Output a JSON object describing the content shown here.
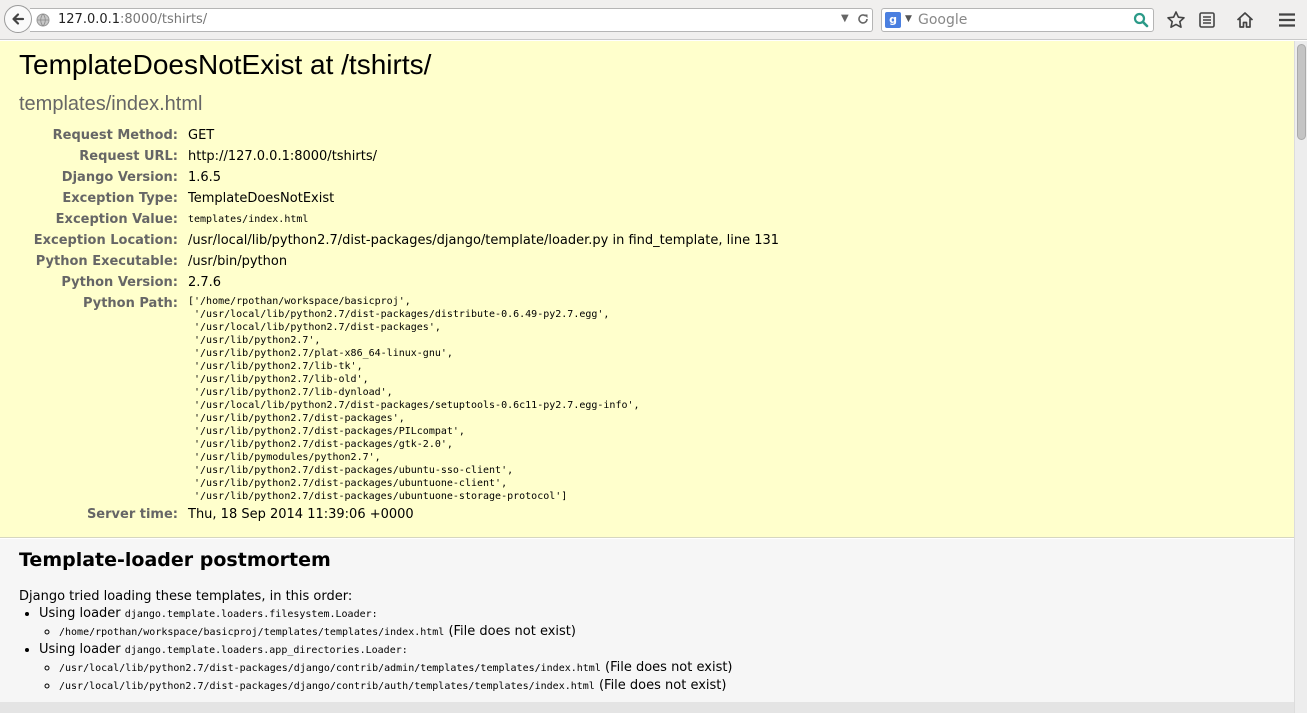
{
  "browser": {
    "url_host": "127.0.0.1",
    "url_rest": ":8000/tshirts/",
    "search_placeholder": "Google",
    "search_engine_glyph": "g"
  },
  "error": {
    "title": "TemplateDoesNotExist at /tshirts/",
    "subtitle": "templates/index.html",
    "meta": [
      {
        "label": "Request Method:",
        "value": "GET"
      },
      {
        "label": "Request URL:",
        "value": "http://127.0.0.1:8000/tshirts/"
      },
      {
        "label": "Django Version:",
        "value": "1.6.5"
      },
      {
        "label": "Exception Type:",
        "value": "TemplateDoesNotExist"
      },
      {
        "label": "Exception Value:",
        "value": "templates/index.html"
      },
      {
        "label": "Exception Location:",
        "value": "/usr/local/lib/python2.7/dist-packages/django/template/loader.py in find_template, line 131"
      },
      {
        "label": "Python Executable:",
        "value": "/usr/bin/python"
      },
      {
        "label": "Python Version:",
        "value": "2.7.6"
      },
      {
        "label": "Python Path:",
        "value": "['/home/rpothan/workspace/basicproj',\n '/usr/local/lib/python2.7/dist-packages/distribute-0.6.49-py2.7.egg',\n '/usr/local/lib/python2.7/dist-packages',\n '/usr/lib/python2.7',\n '/usr/lib/python2.7/plat-x86_64-linux-gnu',\n '/usr/lib/python2.7/lib-tk',\n '/usr/lib/python2.7/lib-old',\n '/usr/lib/python2.7/lib-dynload',\n '/usr/local/lib/python2.7/dist-packages/setuptools-0.6c11-py2.7.egg-info',\n '/usr/lib/python2.7/dist-packages',\n '/usr/lib/python2.7/dist-packages/PILcompat',\n '/usr/lib/python2.7/dist-packages/gtk-2.0',\n '/usr/lib/pymodules/python2.7',\n '/usr/lib/python2.7/dist-packages/ubuntu-sso-client',\n '/usr/lib/python2.7/dist-packages/ubuntuone-client',\n '/usr/lib/python2.7/dist-packages/ubuntuone-storage-protocol']"
      },
      {
        "label": "Server time:",
        "value": "Thu, 18 Sep 2014 11:39:06 +0000"
      }
    ]
  },
  "postmortem": {
    "heading": "Template-loader postmortem",
    "intro": "Django tried loading these templates, in this order:",
    "using_loader": "Using loader",
    "loaders": [
      {
        "name": "django.template.loaders.filesystem.Loader:",
        "templates": [
          {
            "path": "/home/rpothan/workspace/basicproj/templates/templates/index.html",
            "status": "(File does not exist)"
          }
        ]
      },
      {
        "name": "django.template.loaders.app_directories.Loader:",
        "templates": [
          {
            "path": "/usr/local/lib/python2.7/dist-packages/django/contrib/admin/templates/templates/index.html",
            "status": "(File does not exist)"
          },
          {
            "path": "/usr/local/lib/python2.7/dist-packages/django/contrib/auth/templates/templates/index.html",
            "status": "(File does not exist)"
          }
        ]
      }
    ]
  },
  "icons": [
    "back-arrow-icon",
    "globe-icon",
    "dropdown-arrow-icon",
    "reload-icon",
    "google-icon",
    "search-icon",
    "bookmark-star-icon",
    "reading-list-icon",
    "home-icon",
    "menu-icon"
  ],
  "colors": {
    "summary_bg": "#ffffcc",
    "postmortem_bg": "#f6f6f6",
    "label": "#666666"
  }
}
